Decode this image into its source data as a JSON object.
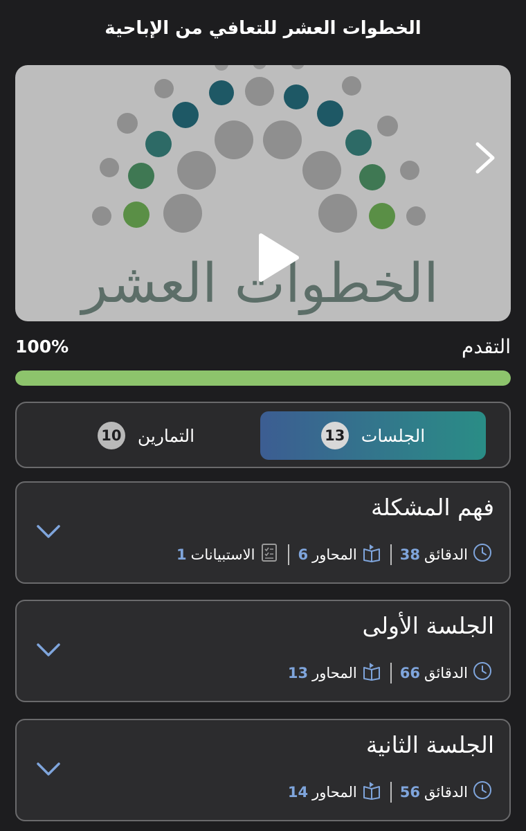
{
  "header": {
    "title": "الخطوات العشر للتعافي من الإباحية"
  },
  "video": {
    "logo_text": "الخطوات العشر"
  },
  "progress": {
    "label": "التقدم",
    "percent_text": "100%",
    "value": 1.0,
    "fill_color": "#8dc46c"
  },
  "tabs": [
    {
      "label": "الجلسات",
      "count": "13",
      "active": true
    },
    {
      "label": "التمارين",
      "count": "10",
      "active": false
    }
  ],
  "sessions": [
    {
      "title": "فهم المشكلة",
      "meta": [
        {
          "icon": "clock-icon",
          "label": "الدقائق",
          "value": "38"
        },
        {
          "icon": "book-icon",
          "label": "المحاور",
          "value": "6"
        },
        {
          "icon": "checklist-icon",
          "label": "الاستبيانات",
          "value": "1"
        }
      ]
    },
    {
      "title": "الجلسة الأولى",
      "meta": [
        {
          "icon": "clock-icon",
          "label": "الدقائق",
          "value": "66"
        },
        {
          "icon": "book-icon",
          "label": "المحاور",
          "value": "13"
        }
      ]
    },
    {
      "title": "الجلسة الثانية",
      "meta": [
        {
          "icon": "clock-icon",
          "label": "الدقائق",
          "value": "56"
        },
        {
          "icon": "book-icon",
          "label": "المحاور",
          "value": "14"
        }
      ]
    }
  ]
}
